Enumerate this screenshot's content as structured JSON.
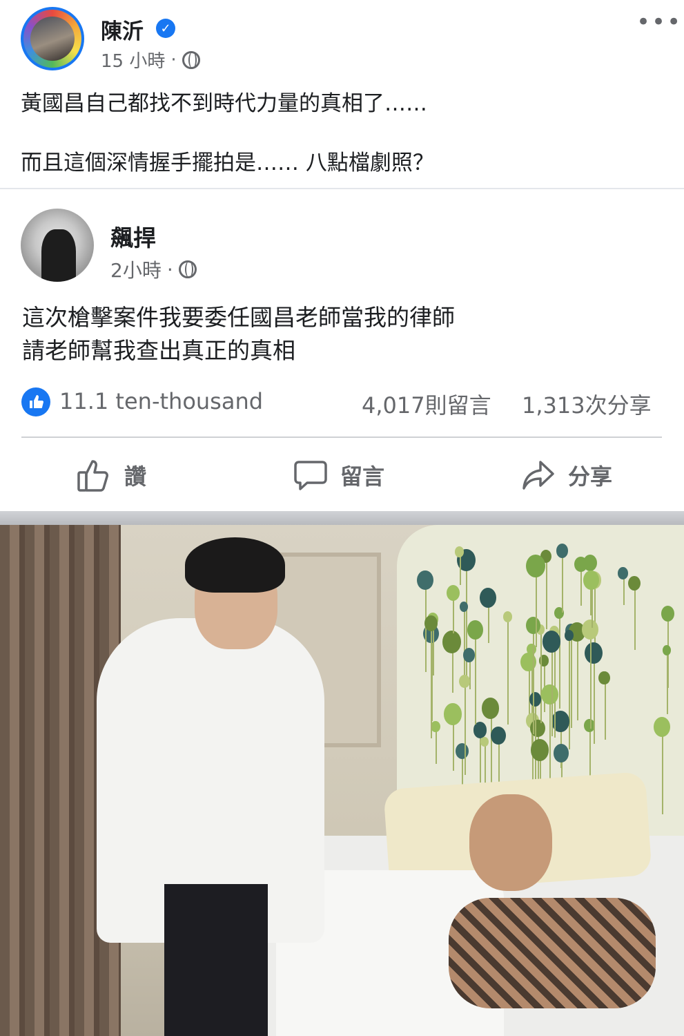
{
  "post": {
    "author": "陳沂",
    "time": "15 小時",
    "dot": "·",
    "lines": [
      "黃國昌自己都找不到時代力量的真相了……",
      "而且這個深情握手擺拍是…… 八點檔劇照？"
    ],
    "more_label": "•••"
  },
  "shared": {
    "author": "飆捍",
    "time": "2小時",
    "dot": "·",
    "lines": [
      "這次槍擊案件我要委任國昌老師當我的律師",
      "請老師幫我查出真正的真相"
    ]
  },
  "stats": {
    "reactions": "11.1 ten-thousand",
    "comments": "4,017則留言",
    "shares": "1,313次分享"
  },
  "actions": {
    "like": "讚",
    "comment": "留言",
    "share": "分享"
  },
  "icons": {
    "verified": "verified-badge-icon",
    "globe": "globe-icon",
    "like": "thumbs-up-icon",
    "comment": "speech-bubble-icon",
    "share": "share-arrow-icon"
  },
  "colors": {
    "brand": "#1877f2",
    "secondary_text": "#65676b"
  }
}
